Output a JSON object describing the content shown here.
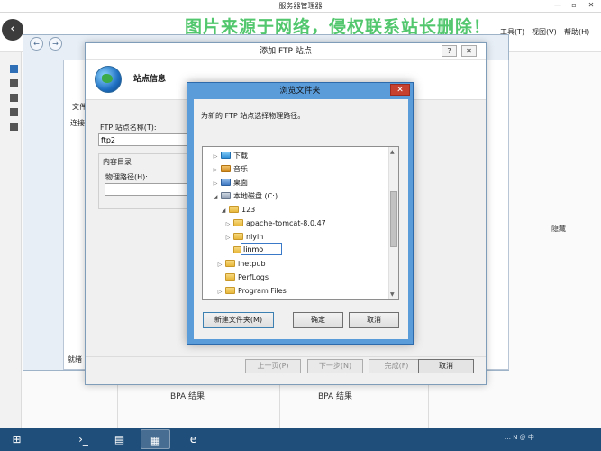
{
  "server_manager": {
    "title": "服务器管理器",
    "menus": [
      "工具(T)",
      "视图(V)",
      "帮助(H)"
    ],
    "watermark": "图片来源于网络，侵权联系站长删除！",
    "bpa_labels": [
      "BPA 结果",
      "BPA 结果"
    ]
  },
  "iis": {
    "side_labels": [
      "文件",
      "连接"
    ],
    "bottom_label": "就绪",
    "hide_label": "隐藏"
  },
  "wizard": {
    "title": "添加 FTP 站点",
    "title_buttons": [
      "?",
      "✕"
    ],
    "heading": "站点信息",
    "site_name_label": "FTP 站点名称(T):",
    "site_name_value": "ftp2",
    "content_dir_label": "内容目录",
    "physical_path_label": "物理路径(H):",
    "physical_path_value": "",
    "buttons": {
      "prev": "上一页(P)",
      "next": "下一步(N)",
      "finish": "完成(F)",
      "cancel": "取消"
    }
  },
  "browse_dialog": {
    "title": "浏览文件夹",
    "close": "✕",
    "prompt": "为新的 FTP 站点选择物理路径。",
    "tree": [
      {
        "label": "下载",
        "toggle": "▷",
        "icon": "down"
      },
      {
        "label": "音乐",
        "toggle": "▷",
        "icon": "music"
      },
      {
        "label": "桌面",
        "toggle": "▷",
        "icon": "desk"
      },
      {
        "label": "本地磁盘 (C:)",
        "toggle": "◢",
        "icon": "drive"
      },
      {
        "label": "123",
        "toggle": "◢",
        "icon": "folder"
      },
      {
        "label": "apache-tomcat-8.0.47",
        "toggle": "▷",
        "icon": "folder"
      },
      {
        "label": "niyin",
        "toggle": "▷",
        "icon": "folder"
      },
      {
        "label": "",
        "toggle": "",
        "icon": "folder"
      },
      {
        "label": "inetpub",
        "toggle": "▷",
        "icon": "folder"
      },
      {
        "label": "PerfLogs",
        "toggle": "",
        "icon": "folder"
      },
      {
        "label": "Program Files",
        "toggle": "▷",
        "icon": "folder"
      }
    ],
    "rename_value": "linmo",
    "buttons": {
      "new_folder": "新建文件夹(M)",
      "ok": "确定",
      "cancel": "取消"
    }
  },
  "taskbar": {
    "tray_text": "… N @ 中"
  }
}
